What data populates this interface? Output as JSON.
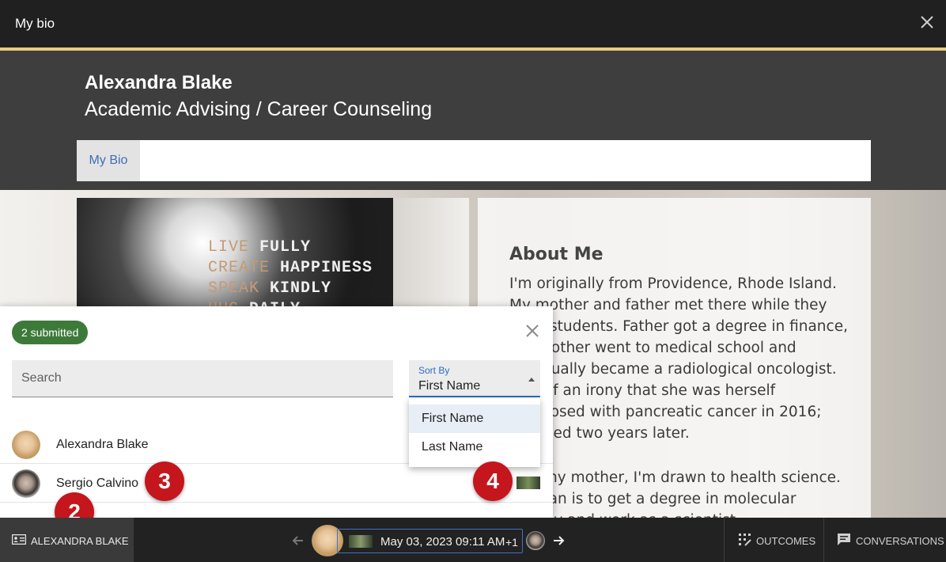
{
  "window": {
    "title": "My bio",
    "close_icon": "close-icon"
  },
  "profile": {
    "name": "Alexandra Blake",
    "department": "Academic Advising / Career Counseling"
  },
  "nav": {
    "tabs": [
      {
        "label": "My Bio",
        "active": true
      }
    ]
  },
  "photo": {
    "sign_lines": [
      {
        "a": "LIVE",
        "b": "FULLY"
      },
      {
        "a": "CREATE",
        "b": "HAPPINESS"
      },
      {
        "a": "SPEAK",
        "b": "KINDLY"
      },
      {
        "a": "HUG",
        "b": "DAILY"
      }
    ]
  },
  "about": {
    "heading": "About Me",
    "paragraph1": "I'm originally from Providence, Rhode Island. My mother and father met there while they were students. Father got a degree in finance, my mother went to medical school and eventually became a radiological oncologist. Sort of an irony that she was herself diagnosed with pancreatic cancer in 2016; she died two years later.",
    "paragraph2": "Like my mother, I'm drawn to health science. My plan is to get a degree in molecular biology and work as a scientist."
  },
  "submissions": {
    "badge": "2 submitted",
    "search_placeholder": "Search",
    "sort": {
      "label": "Sort By",
      "value": "First Name",
      "options": [
        "First Name",
        "Last Name"
      ]
    },
    "students": [
      {
        "name": "Alexandra Blake"
      },
      {
        "name": "Sergio Calvino"
      }
    ]
  },
  "markers": [
    "2",
    "3",
    "4"
  ],
  "toolbar": {
    "student_label": "ALEXANDRA BLAKE",
    "submission_date": "May 03, 2023 09:11 AM",
    "more_count": "+1",
    "outcomes_label": "OUTCOMES",
    "conversations_label": "CONVERSATIONS"
  },
  "colors": {
    "accent_line": "#e8cd7c",
    "badge": "#3d7a3a",
    "link": "#3b6fb6",
    "marker": "#c4161c",
    "focus": "#2f6cbc"
  }
}
